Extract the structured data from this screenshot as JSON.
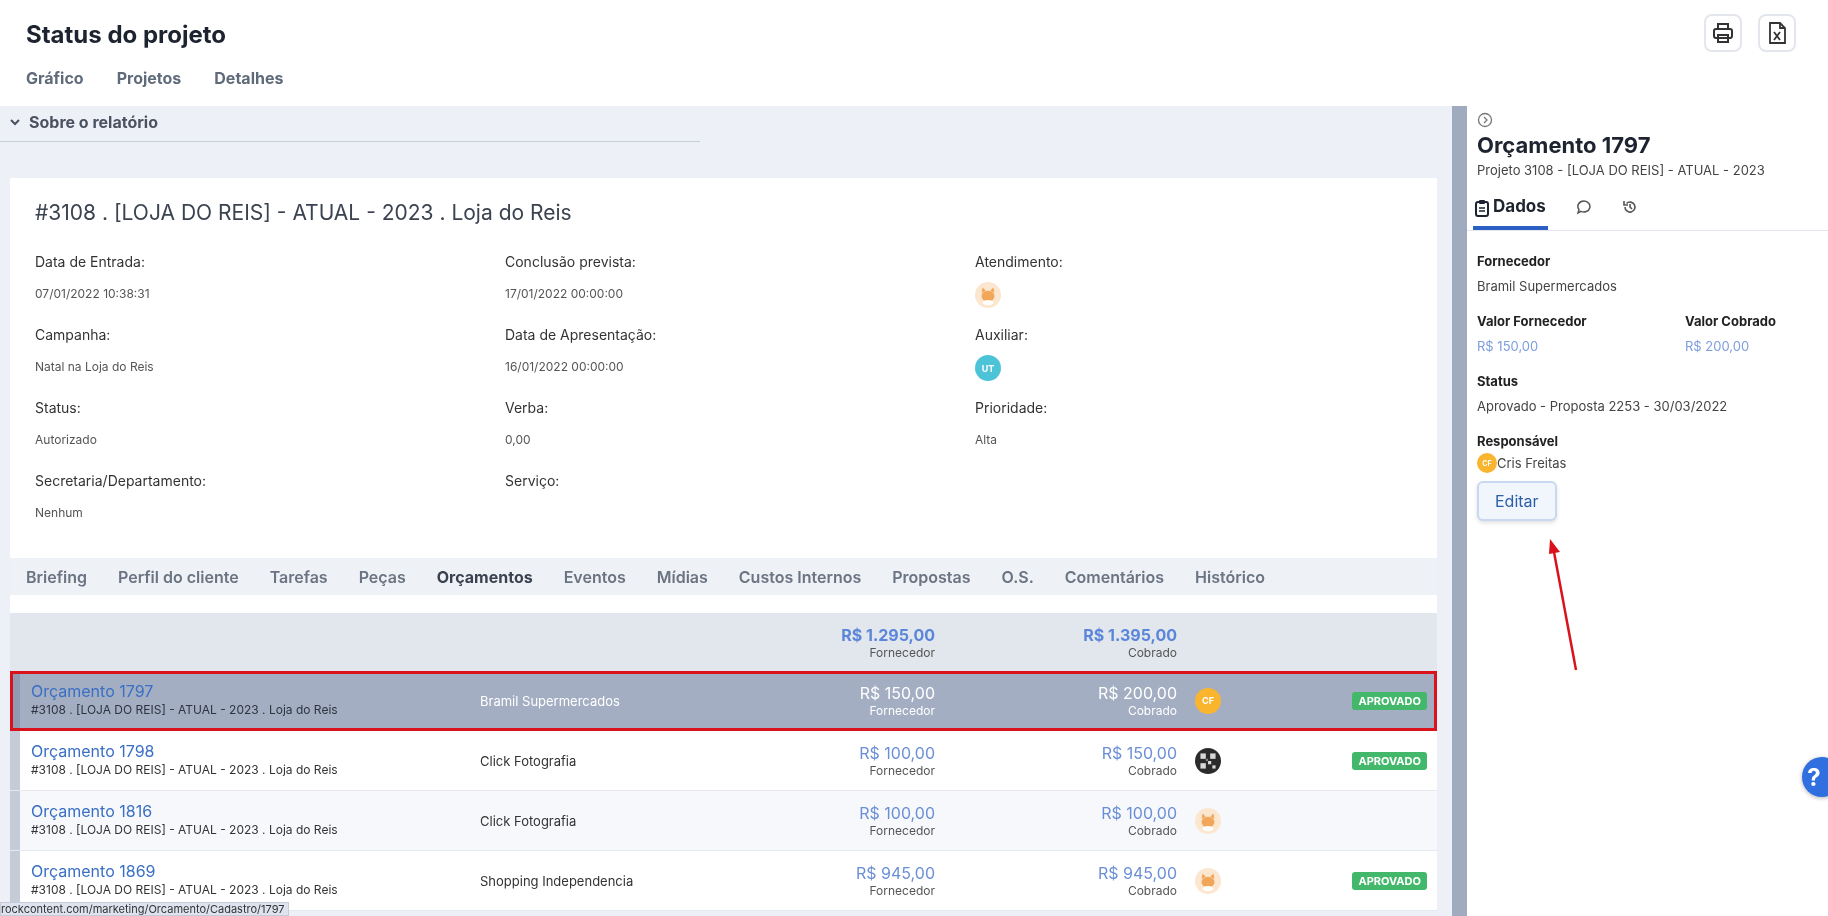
{
  "page": {
    "title": "Status do projeto",
    "nav": [
      {
        "label": "Gráfico"
      },
      {
        "label": "Projetos"
      },
      {
        "label": "Detalhes"
      }
    ]
  },
  "about": {
    "label": "Sobre o relatório",
    "expanded": true
  },
  "project": {
    "title": "#3108 . [LOJA DO REIS] - ATUAL - 2023 . Loja do Reis",
    "fields": [
      {
        "label": "Data de Entrada:",
        "kind": "text",
        "value": "07/01/2022 10:38:31"
      },
      {
        "label": "Conclusão prevista:",
        "kind": "text",
        "value": "17/01/2022 00:00:00"
      },
      {
        "label": "Atendimento:",
        "kind": "picture"
      },
      {
        "label": "Campanha:",
        "kind": "text",
        "value": "Natal na Loja do Reis"
      },
      {
        "label": "Data de Apresentação:",
        "kind": "text",
        "value": "16/01/2022 00:00:00"
      },
      {
        "label": "Auxiliar:",
        "kind": "initials",
        "initials": "UT",
        "color": "#4dc3d8"
      },
      {
        "label": "Status:",
        "kind": "text",
        "value": "Autorizado"
      },
      {
        "label": "Verba:",
        "kind": "text",
        "value": "0,00"
      },
      {
        "label": "Prioridade:",
        "kind": "text",
        "value": "Alta"
      },
      {
        "label": "Secretaria/Departamento:",
        "kind": "text",
        "value": "Nenhum"
      },
      {
        "label": "Serviço:",
        "kind": "text"
      }
    ]
  },
  "tabs": [
    {
      "label": "Briefing",
      "selected": false
    },
    {
      "label": "Perfil do cliente",
      "selected": false
    },
    {
      "label": "Tarefas",
      "selected": false
    },
    {
      "label": "Peças",
      "selected": false
    },
    {
      "label": "Orçamentos",
      "selected": true
    },
    {
      "label": "Eventos",
      "selected": false
    },
    {
      "label": "Mídias",
      "selected": false
    },
    {
      "label": "Custos Internos",
      "selected": false
    },
    {
      "label": "Propostas",
      "selected": false
    },
    {
      "label": "O.S.",
      "selected": false
    },
    {
      "label": "Comentários",
      "selected": false
    },
    {
      "label": "Histórico",
      "selected": false
    }
  ],
  "table": {
    "totals": {
      "cost": "R$ 1.295,00",
      "cost_label": "Fornecedor",
      "charged": "R$ 1.395,00",
      "charged_label": "Cobrado"
    },
    "rows": [
      {
        "title": "Orçamento 1797",
        "subtitle": "#3108 . [LOJA DO REIS] - ATUAL - 2023 . Loja do Reis",
        "supplier": "Bramil Supermercados",
        "cost": "R$ 150,00",
        "cost_label": "Fornecedor",
        "charged": "R$ 200,00",
        "charged_label": "Cobrado",
        "avatar": {
          "kind": "initials",
          "initials": "CF",
          "color": "#f9b52e"
        },
        "status": "APROVADO",
        "selected": true
      },
      {
        "title": "Orçamento 1798",
        "subtitle": "#3108 . [LOJA DO REIS] - ATUAL - 2023 . Loja do Reis",
        "supplier": "Click Fotografia",
        "cost": "R$ 100,00",
        "cost_label": "Fornecedor",
        "charged": "R$ 150,00",
        "charged_label": "Cobrado",
        "avatar": {
          "kind": "pattern"
        },
        "status": "APROVADO",
        "selected": false
      },
      {
        "title": "Orçamento 1816",
        "subtitle": "#3108 . [LOJA DO REIS] - ATUAL - 2023 . Loja do Reis",
        "supplier": "Click Fotografia",
        "cost": "R$ 100,00",
        "cost_label": "Fornecedor",
        "charged": "R$ 100,00",
        "charged_label": "Cobrado",
        "selected": false
      },
      {
        "title": "Orçamento 1869",
        "subtitle": "#3108 . [LOJA DO REIS] - ATUAL - 2023 . Loja do Reis",
        "supplier": "Shopping Independencia",
        "cost": "R$ 945,00",
        "cost_label": "Fornecedor",
        "charged": "R$ 945,00",
        "charged_label": "Cobrado",
        "status": "APROVADO",
        "selected": false
      }
    ]
  },
  "status_bar": {
    "url": "rockcontent.com/marketing/Orcamento/Cadastro/1797"
  },
  "panel": {
    "title": "Orçamento 1797",
    "subtitle": "Projeto 3108 - [LOJA DO REIS] - ATUAL - 2023",
    "tabs": [
      {
        "kind": "data",
        "label": "Dados",
        "selected": true
      },
      {
        "kind": "comments",
        "selected": false
      },
      {
        "kind": "history",
        "selected": false
      }
    ],
    "supplier_label": "Fornecedor",
    "supplier": "Bramil Supermercados",
    "cost_label": "Valor Fornecedor",
    "cost": "R$ 150,00",
    "charged_label": "Valor Cobrado",
    "charged": "R$ 200,00",
    "status_label": "Status",
    "status": "Aprovado - Proposta 2253 - 30/03/2022",
    "owner_label": "Responsável",
    "owner": {
      "name": "Cris Freitas",
      "initials": "CF",
      "color": "#f9b52e"
    },
    "button": "Editar"
  },
  "help": {
    "label": "?"
  }
}
